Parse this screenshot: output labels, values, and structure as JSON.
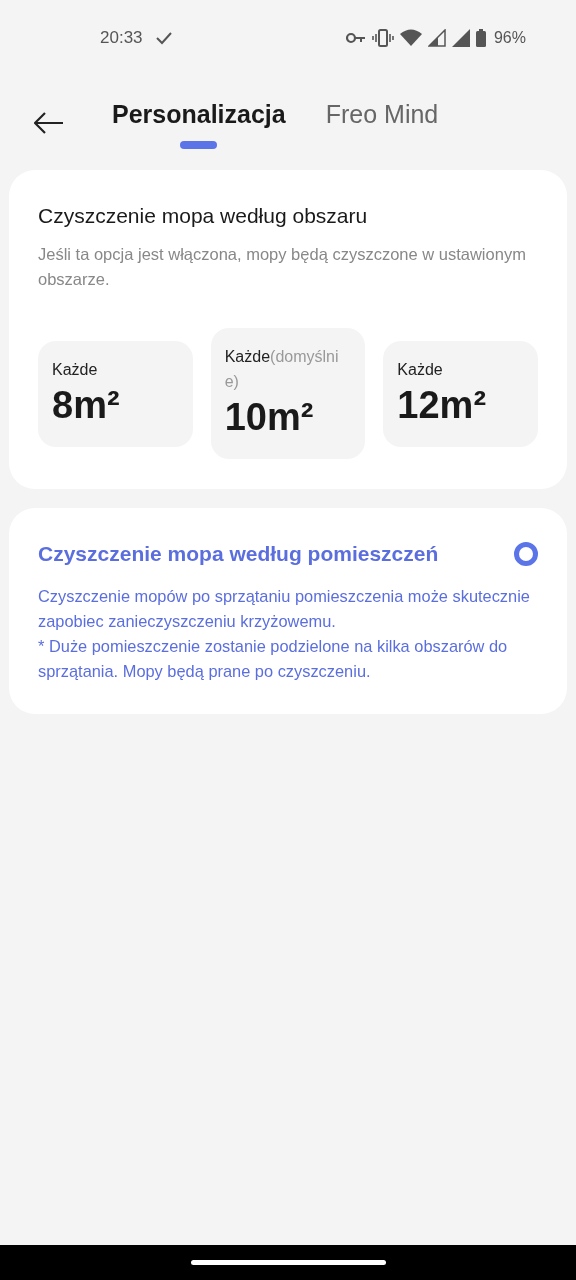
{
  "status_bar": {
    "time": "20:33",
    "battery": "96%"
  },
  "tabs": [
    {
      "label": "Personalizacja",
      "selected": true
    },
    {
      "label": "Freo Mind",
      "selected": false
    }
  ],
  "cards": [
    {
      "title": "Czyszczenie mopa według obszaru",
      "description": "Jeśli ta opcja jest włączona, mopy będą czyszczone w ustawionym obszarze.",
      "selected": false,
      "options": [
        {
          "label": "Każde",
          "value": "8m²"
        },
        {
          "label": "Każde",
          "note": "(domyślnie)",
          "value": "10m²"
        },
        {
          "label": "Każde",
          "value": "12m²"
        }
      ]
    },
    {
      "title": "Czyszczenie mopa według pomieszczeń",
      "description": "Czyszczenie mopów po sprzątaniu pomieszczenia może skutecznie zapobiec zanieczyszczeniu krzyżowemu.\n* Duże pomieszczenie zostanie podzielone na kilka obszarów do sprzątania. Mopy będą prane po czyszczeniu.",
      "selected": true
    }
  ]
}
